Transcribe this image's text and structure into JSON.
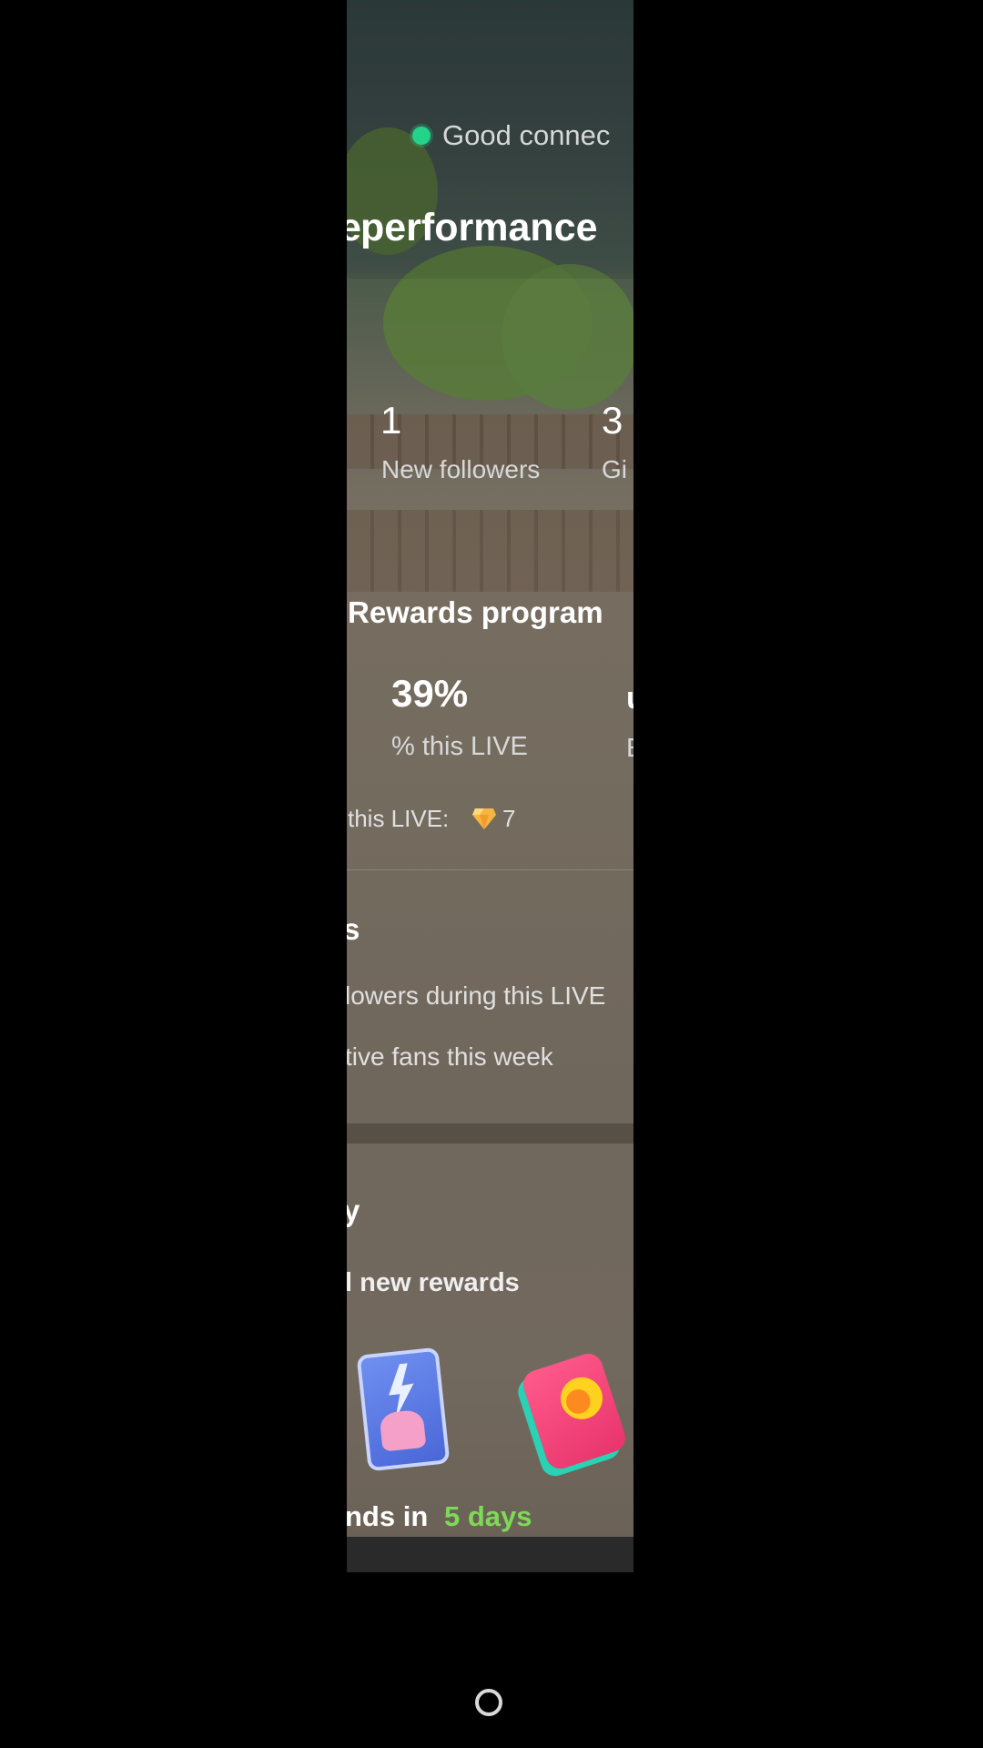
{
  "connection": {
    "status_text": "Good connec",
    "status_color": "#24d38a"
  },
  "performance": {
    "title": "performance"
  },
  "stats": [
    {
      "value": "1",
      "label": "New followers"
    },
    {
      "value": "3",
      "label": "Gi"
    }
  ],
  "rewards_program": {
    "title": "Rewards program",
    "metrics": [
      {
        "value": "39%",
        "label": "% this LIVE"
      },
      {
        "value": "u",
        "label": "E"
      }
    ],
    "earned_label": "this LIVE:",
    "earned_icon": "diamond-icon",
    "earned_value": "7"
  },
  "fans": {
    "title_fragment": "s",
    "line1": "lowers during this LIVE",
    "line2": "tive fans this week"
  },
  "weekly": {
    "title_fragment": "y",
    "subtitle": "l new rewards",
    "rewards": [
      {
        "icon": "lightning-card-icon"
      },
      {
        "icon": "fire-phone-icon"
      }
    ],
    "ends_prefix": "nds in",
    "ends_value": "5 days",
    "ends_color": "#7ed957"
  },
  "nav": {
    "home_icon": "home-circle-icon"
  }
}
